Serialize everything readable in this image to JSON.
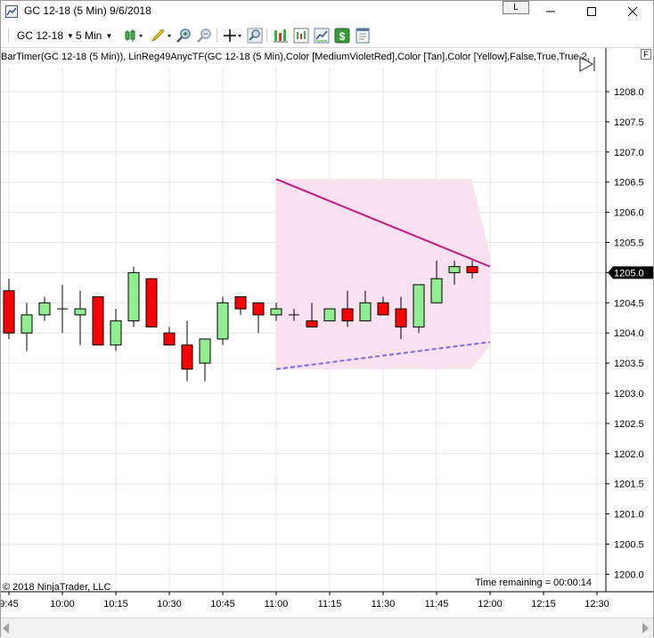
{
  "window": {
    "title": "GC 12-18 (5 Min)  9/6/2018",
    "link_button": "L",
    "controls": [
      "minimize",
      "maximize",
      "close"
    ]
  },
  "toolbar": {
    "instrument": "GC 12-18",
    "interval": "5 Min",
    "icons": [
      "bar-style-icon",
      "drawing-tool-icon",
      "zoom-in-icon",
      "zoom-out-icon",
      "crosshair-icon",
      "search-icon",
      "strategy-icon",
      "indicator-icon",
      "chart-trader-icon",
      "dollar-icon",
      "properties-icon"
    ]
  },
  "indicator_label": "BarTimer(GC 12-18 (5 Min)), LinReg49AnycTF(GC 12-18 (5 Min),Color [MediumVioletRed],Color [Tan],Color [Yellow],False,True,True,2,",
  "f_button": "F",
  "copyright": "© 2018 NinjaTrader, LLC",
  "time_remaining": "Time remaining = 00:00:14",
  "colors": {
    "up_candle": "#90ee90",
    "down_candle": "#ff0000",
    "regression_line": "#c71585",
    "lower_line": "#7b68ee",
    "channel_fill": "#f9e1ef",
    "price_marker_bg": "#000000",
    "grid": "#e6e6e6"
  },
  "chart_data": {
    "type": "candlestick",
    "x_tick_labels": [
      "9:45",
      "10:00",
      "10:15",
      "10:30",
      "10:45",
      "11:00",
      "11:15",
      "11:30",
      "11:45",
      "12:00",
      "12:15",
      "12:30"
    ],
    "y_tick_labels": [
      "1208.0",
      "1207.5",
      "1207.0",
      "1206.5",
      "1206.0",
      "1205.5",
      "1205.0",
      "1204.5",
      "1204.0",
      "1203.5",
      "1203.0",
      "1202.5",
      "1202.0",
      "1201.5",
      "1201.0",
      "1200.5",
      "1200.0"
    ],
    "ylim": [
      1199.9,
      1208.2
    ],
    "current_price": "1205.0",
    "candles": [
      {
        "o": 1204.7,
        "h": 1204.9,
        "l": 1203.9,
        "c": 1204.0
      },
      {
        "o": 1204.0,
        "h": 1204.5,
        "l": 1203.7,
        "c": 1204.3
      },
      {
        "o": 1204.3,
        "h": 1204.6,
        "l": 1204.2,
        "c": 1204.5
      },
      {
        "o": 1204.4,
        "h": 1204.8,
        "l": 1204.0,
        "c": 1204.4
      },
      {
        "o": 1204.3,
        "h": 1204.7,
        "l": 1203.8,
        "c": 1204.4
      },
      {
        "o": 1204.6,
        "h": 1204.6,
        "l": 1203.8,
        "c": 1203.8
      },
      {
        "o": 1203.8,
        "h": 1204.4,
        "l": 1203.7,
        "c": 1204.2
      },
      {
        "o": 1204.2,
        "h": 1205.1,
        "l": 1204.1,
        "c": 1205.0
      },
      {
        "o": 1204.9,
        "h": 1204.9,
        "l": 1204.1,
        "c": 1204.1
      },
      {
        "o": 1204.0,
        "h": 1204.1,
        "l": 1203.8,
        "c": 1203.8
      },
      {
        "o": 1203.8,
        "h": 1204.2,
        "l": 1203.2,
        "c": 1203.4
      },
      {
        "o": 1203.5,
        "h": 1203.9,
        "l": 1203.2,
        "c": 1203.9
      },
      {
        "o": 1203.9,
        "h": 1204.6,
        "l": 1203.8,
        "c": 1204.5
      },
      {
        "o": 1204.6,
        "h": 1204.6,
        "l": 1204.3,
        "c": 1204.4
      },
      {
        "o": 1204.5,
        "h": 1204.5,
        "l": 1204.0,
        "c": 1204.3
      },
      {
        "o": 1204.3,
        "h": 1204.5,
        "l": 1204.2,
        "c": 1204.4
      },
      {
        "o": 1204.3,
        "h": 1204.4,
        "l": 1204.2,
        "c": 1204.3
      },
      {
        "o": 1204.2,
        "h": 1204.5,
        "l": 1204.1,
        "c": 1204.1
      },
      {
        "o": 1204.2,
        "h": 1204.4,
        "l": 1204.2,
        "c": 1204.4
      },
      {
        "o": 1204.4,
        "h": 1204.7,
        "l": 1204.1,
        "c": 1204.2
      },
      {
        "o": 1204.2,
        "h": 1204.7,
        "l": 1204.2,
        "c": 1204.5
      },
      {
        "o": 1204.5,
        "h": 1204.6,
        "l": 1204.3,
        "c": 1204.3
      },
      {
        "o": 1204.4,
        "h": 1204.6,
        "l": 1203.9,
        "c": 1204.1
      },
      {
        "o": 1204.1,
        "h": 1204.8,
        "l": 1204.0,
        "c": 1204.8
      },
      {
        "o": 1204.5,
        "h": 1205.2,
        "l": 1204.5,
        "c": 1204.9
      },
      {
        "o": 1205.0,
        "h": 1205.2,
        "l": 1204.8,
        "c": 1205.1
      },
      {
        "o": 1205.1,
        "h": 1205.2,
        "l": 1204.9,
        "c": 1205.0
      }
    ],
    "regression_upper": {
      "x": [
        "11:00",
        "12:00"
      ],
      "y": [
        1206.55,
        1205.1
      ]
    },
    "regression_lower": {
      "x": [
        "11:00",
        "12:00"
      ],
      "y": [
        1203.4,
        1203.85
      ]
    },
    "channel": {
      "start": "11:00",
      "end": "11:55",
      "top": 1206.55,
      "bottom": 1203.4
    }
  }
}
